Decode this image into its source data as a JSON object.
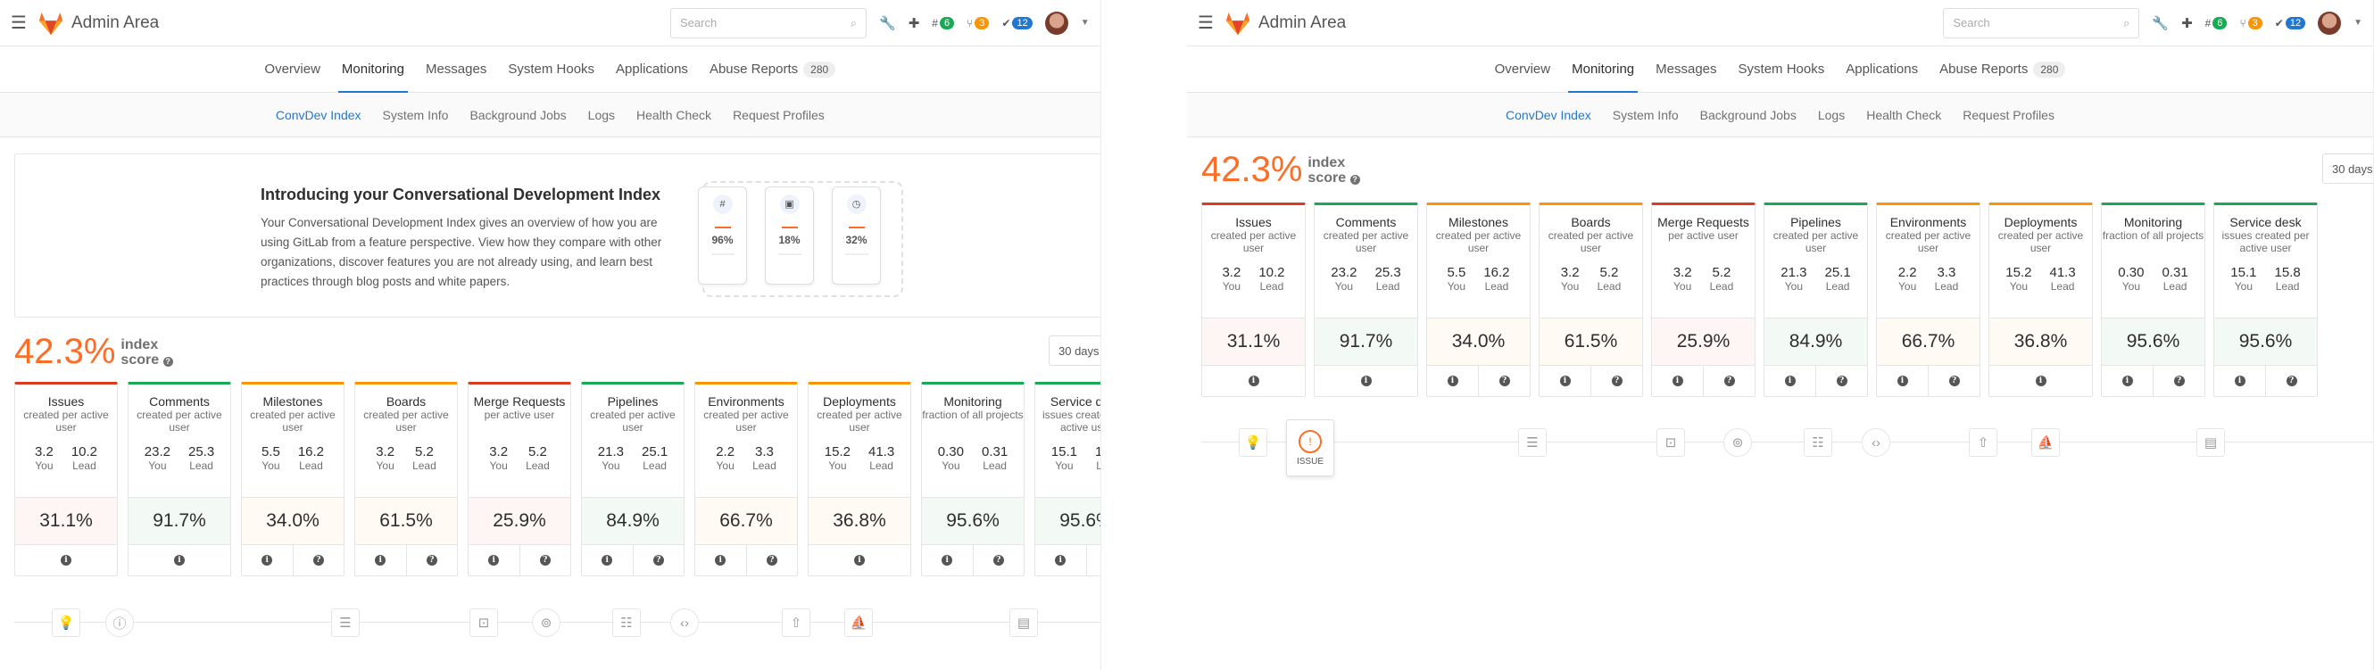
{
  "header": {
    "title": "Admin Area",
    "search_placeholder": "Search",
    "badges": [
      {
        "icon": "issues-icon",
        "count": "6",
        "color": "#1aaa55"
      },
      {
        "icon": "merge-request-icon",
        "count": "3",
        "color": "#fc9403"
      },
      {
        "icon": "todo-icon",
        "count": "12",
        "color": "#1f78d1"
      }
    ]
  },
  "nav": {
    "tabs": [
      "Overview",
      "Monitoring",
      "Messages",
      "System Hooks",
      "Applications",
      "Abuse Reports"
    ],
    "active_tab": "Monitoring",
    "abuse_count": "280",
    "subtabs": [
      "ConvDev Index",
      "System Info",
      "Background Jobs",
      "Logs",
      "Health Check",
      "Request Profiles"
    ],
    "active_subtab": "ConvDev Index"
  },
  "callout": {
    "title": "Introducing your Conversational Development Index",
    "body": "Your Conversational Development Index gives an overview of how you are using GitLab from a feature perspective. View how they compare with other organizations, discover features you are not already using, and learn best practices through blog posts and white papers.",
    "previews": [
      "96%",
      "18%",
      "32%"
    ]
  },
  "index": {
    "score": "42.3%",
    "label_1": "index",
    "label_2": "score",
    "period": "30 days"
  },
  "cards": [
    {
      "title": "Issues",
      "desc": "created per active user",
      "you": "3.2",
      "lead": "10.2",
      "pct": "31.1%",
      "color": "#db3b21",
      "bg": "#fdf6f5",
      "help": false
    },
    {
      "title": "Comments",
      "desc": "created per active user",
      "you": "23.2",
      "lead": "25.3",
      "pct": "91.7%",
      "color": "#1aaa55",
      "bg": "#f3faf5",
      "help": false
    },
    {
      "title": "Milestones",
      "desc": "created per active user",
      "you": "5.5",
      "lead": "16.2",
      "pct": "34.0%",
      "color": "#fc9403",
      "bg": "#fffaf3",
      "help": true
    },
    {
      "title": "Boards",
      "desc": "created per active user",
      "you": "3.2",
      "lead": "5.2",
      "pct": "61.5%",
      "color": "#fc9403",
      "bg": "#fffaf3",
      "help": true
    },
    {
      "title": "Merge Requests",
      "desc": "per active user",
      "you": "3.2",
      "lead": "5.2",
      "pct": "25.9%",
      "color": "#db3b21",
      "bg": "#fdf6f5",
      "help": true
    },
    {
      "title": "Pipelines",
      "desc": "created per active user",
      "you": "21.3",
      "lead": "25.1",
      "pct": "84.9%",
      "color": "#1aaa55",
      "bg": "#f3faf5",
      "help": true
    },
    {
      "title": "Environments",
      "desc": "created per active user",
      "you": "2.2",
      "lead": "3.3",
      "pct": "66.7%",
      "color": "#fc9403",
      "bg": "#fffaf3",
      "help": true
    },
    {
      "title": "Deployments",
      "desc": "created per active user",
      "you": "15.2",
      "lead": "41.3",
      "pct": "36.8%",
      "color": "#fc9403",
      "bg": "#fffaf3",
      "help": false
    },
    {
      "title": "Monitoring",
      "desc": "fraction of all projects",
      "you": "0.30",
      "lead": "0.31",
      "pct": "95.6%",
      "color": "#1aaa55",
      "bg": "#f3faf5",
      "help": true
    },
    {
      "title": "Service desk",
      "desc": "issues created per active user",
      "you": "15.1",
      "lead": "15.8",
      "pct": "95.6%",
      "color": "#1aaa55",
      "bg": "#f3faf5",
      "help": true
    }
  ],
  "labels": {
    "you": "You",
    "lead": "Lead"
  },
  "timeline": {
    "selected_label": "ISSUE",
    "selected_mark": "!",
    "icons": [
      "lightbulb-icon",
      "issue-icon",
      "list-icon",
      "code-review-icon",
      "merge-icon",
      "checklist-icon",
      "code-icon",
      "rocket-icon",
      "deploy-icon",
      "monitor-icon"
    ]
  }
}
